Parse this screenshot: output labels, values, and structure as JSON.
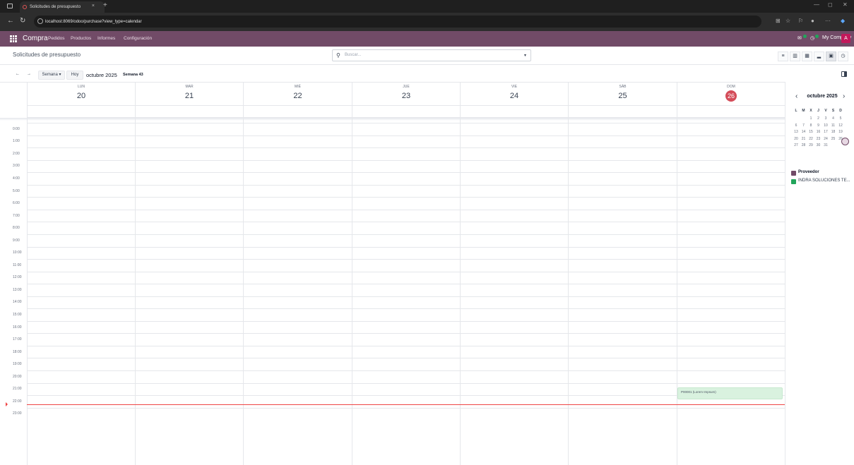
{
  "browser": {
    "tab_title": "Solicitudes de presupuesto",
    "tab_close": "×",
    "new_tab": "+",
    "url": "localhost:8069/odoo/purchase?view_type=calendar"
  },
  "topnav": {
    "brand": "Compra",
    "menu": [
      "Pedidos",
      "Productos",
      "Informes",
      "Configuración"
    ],
    "company": "My Company",
    "avatar": "A"
  },
  "control_panel": {
    "title": "Solicitudes de presupuesto",
    "search_placeholder": "Buscar..."
  },
  "calendar": {
    "scale_label": "Semana ▾",
    "today_label": "Hoy",
    "period": "octubre 2025",
    "week": "Semana 43",
    "days": [
      {
        "name": "LUN",
        "num": "20"
      },
      {
        "name": "MAR",
        "num": "21"
      },
      {
        "name": "MIÉ",
        "num": "22"
      },
      {
        "name": "JUE",
        "num": "23"
      },
      {
        "name": "VIE",
        "num": "24"
      },
      {
        "name": "SÁB",
        "num": "25"
      },
      {
        "name": "DOM",
        "num": "26"
      }
    ],
    "hours": [
      "0:00",
      "1:00",
      "2:00",
      "3:00",
      "4:00",
      "5:00",
      "6:00",
      "7:00",
      "8:00",
      "9:00",
      "10:00",
      "11:00",
      "12:00",
      "13:00",
      "14:00",
      "15:00",
      "16:00",
      "17:00",
      "18:00",
      "19:00",
      "20:00",
      "21:00",
      "22:00",
      "23:00"
    ],
    "event": {
      "label": "P00001 (Lorem Impsum)"
    }
  },
  "mini_calendar": {
    "title": "octubre 2025",
    "dow": [
      "L",
      "M",
      "X",
      "J",
      "V",
      "S",
      "D"
    ],
    "weeks": [
      [
        "",
        "",
        "1",
        "2",
        "3",
        "4",
        "5"
      ],
      [
        "6",
        "7",
        "8",
        "9",
        "10",
        "11",
        "12"
      ],
      [
        "13",
        "14",
        "15",
        "16",
        "17",
        "18",
        "19"
      ],
      [
        "20",
        "21",
        "22",
        "23",
        "24",
        "25",
        "26"
      ],
      [
        "27",
        "28",
        "29",
        "30",
        "31",
        "",
        ""
      ]
    ]
  },
  "filters": {
    "group_label": "Proveedor",
    "items": [
      "INDRA SOLUCIONES TE..."
    ],
    "colors": {
      "group": "#714b67",
      "item": "#22a55b"
    }
  },
  "colors": {
    "brand": "#714b67",
    "today": "#d44c59",
    "now_line": "#ef4444"
  }
}
